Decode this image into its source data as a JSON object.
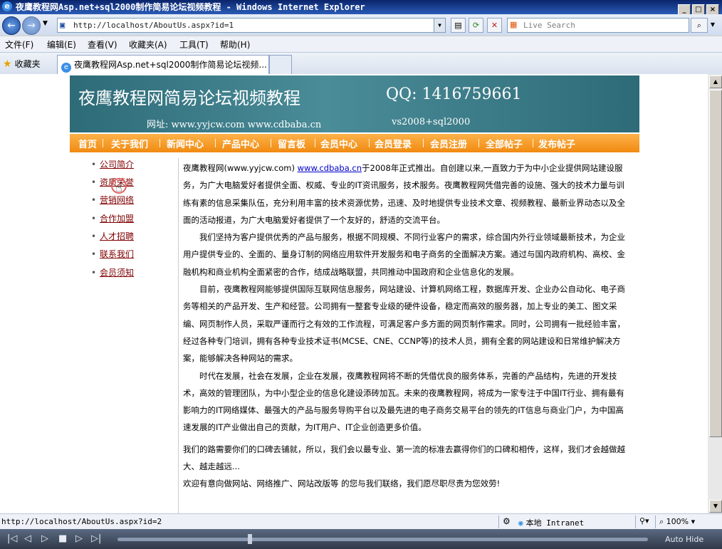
{
  "window": {
    "title": "夜鹰教程网Asp.net+sql2000制作简易论坛视频教程 - Windows Internet Explorer",
    "controls": [
      "_",
      "□",
      "×"
    ]
  },
  "address_bar": {
    "url": "http://localhost/AboutUs.aspx?id=1",
    "search_placeholder": "Live Search"
  },
  "menu": [
    "文件(F)",
    "编辑(E)",
    "查看(V)",
    "收藏夹(A)",
    "工具(T)",
    "帮助(H)"
  ],
  "favorites": {
    "label": "收藏夹",
    "tab_title": "夜鹰教程网Asp.net+sql2000制作简易论坛视频..."
  },
  "banner": {
    "title": "夜鹰教程网简易论坛视频教程",
    "qq": "QQ: 1416759661",
    "site": "网址: www.yyjcw.com   www.cdbaba.cn",
    "stack": "vs2008+sql2000"
  },
  "nav": [
    "首页",
    "关于我们",
    "新闻中心",
    "产品中心",
    "留言板",
    "会员中心",
    "会员登录",
    "会员注册",
    "全部帖子",
    "发布帖子"
  ],
  "sidebar": [
    "公司简介",
    "资质荣誉",
    "营销网络",
    "合作加盟",
    "人才招聘",
    "联系我们",
    "会员须知"
  ],
  "article": {
    "p1_start": "夜鹰教程网(www.yyjcw.com) ",
    "p1_link": "www.cdbaba.cn",
    "p1_rest": "于2008年正式推出。自创建以来,一直致力于为中小企业提供网站建设服务，为广大电脑爱好者提供全面、权威、专业的IT资讯服务，技术服务。夜鹰教程网凭借完善的设施、强大的技术力量与训练有素的信息采集队伍，充分利用丰富的技术资源优势，迅速、及时地提供专业技术文章、视频教程、最新业界动态以及全面的活动报道，为广大电脑爱好者提供了一个友好的，舒适的交流平台。",
    "p2": "我们坚持为客户提供优秀的产品与服务，根据不同规模、不同行业客户的需求，综合国内外行业领域最新技术，为企业用户提供专业的、全面的、量身订制的网络应用软件开发服务和电子商务的全面解决方案。通过与国内政府机构、高校、金融机构和商业机构全面紧密的合作，结成战略联盟，共同推动中国政府和企业信息化的发展。",
    "p3": "目前，夜鹰教程网能够提供国际互联网信息服务，网站建设、计算机网络工程，数据库开发、企业办公自动化、电子商务等相关的产品开发、生产和经营。公司拥有一整套专业级的硬件设备，稳定而高效的服务器，加上专业的美工、图文采编、网页制作人员，采取严谨而行之有效的工作流程，可满足客户多方面的网页制作需求。同时，公司拥有一批经验丰富，经过各种专门培训，拥有各种专业技术证书(MCSE、CNE、CCNP等)的技术人员，拥有全套的网站建设和日常维护解决方案，能够解决各种网站的需求。",
    "p4": "时代在发展，社会在发展，企业在发展，夜鹰教程网将不断的凭借优良的服务体系，完善的产品结构，先进的开发技术，高效的管理团队，为中小型企业的信息化建设添砖加瓦。未来的夜鹰教程网，将成为一家专注于中国IT行业、拥有最有影响力的IT网络媒体、最强大的产品与服务导购平台以及最先进的电子商务交易平台的领先的IT信息与商业门户，为中国高速发展的IT产业做出自己的贡献，为IT用户、IT企业创造更多价值。",
    "p5": "我们的路需要你们的口碑去铺就，所以，我们会以最专业、第一流的标准去赢得你们的口碑和相传，这样，我们才会越做越大、越走越远...",
    "p6": "欢迎有意向做网站、网络推广、网站改版等 的您与我们联络，我们愿尽职尽责为您效劳!"
  },
  "status": {
    "url": "http://localhost/AboutUs.aspx?id=2",
    "zone": "本地 Intranet",
    "zoom": "100%"
  },
  "player": {
    "auto_hide": "Auto Hide",
    "progress": 0.25
  }
}
